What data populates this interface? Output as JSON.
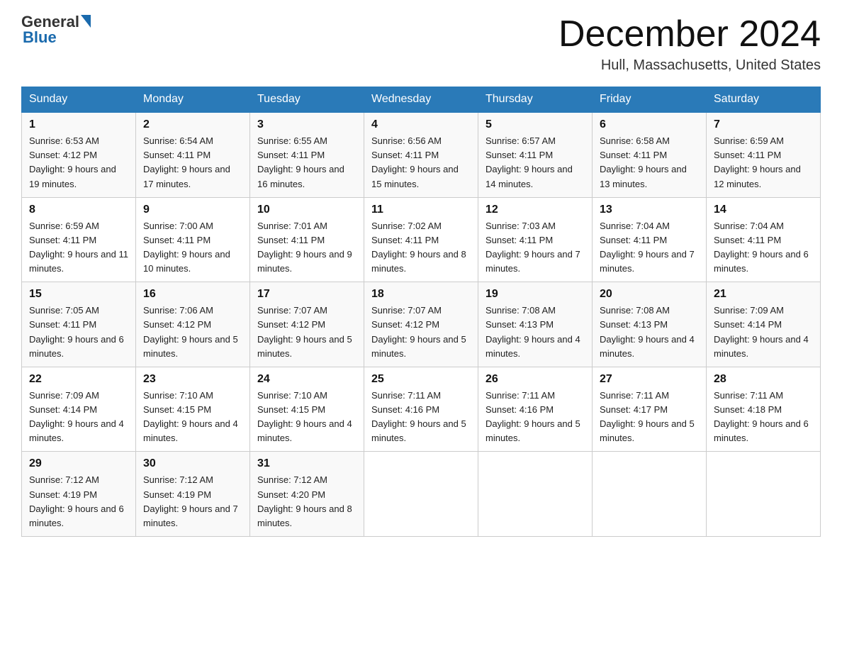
{
  "header": {
    "logo_general": "General",
    "logo_blue": "Blue",
    "month_title": "December 2024",
    "location": "Hull, Massachusetts, United States"
  },
  "days_of_week": [
    "Sunday",
    "Monday",
    "Tuesday",
    "Wednesday",
    "Thursday",
    "Friday",
    "Saturday"
  ],
  "weeks": [
    [
      {
        "num": "1",
        "sunrise": "6:53 AM",
        "sunset": "4:12 PM",
        "daylight": "9 hours and 19 minutes."
      },
      {
        "num": "2",
        "sunrise": "6:54 AM",
        "sunset": "4:11 PM",
        "daylight": "9 hours and 17 minutes."
      },
      {
        "num": "3",
        "sunrise": "6:55 AM",
        "sunset": "4:11 PM",
        "daylight": "9 hours and 16 minutes."
      },
      {
        "num": "4",
        "sunrise": "6:56 AM",
        "sunset": "4:11 PM",
        "daylight": "9 hours and 15 minutes."
      },
      {
        "num": "5",
        "sunrise": "6:57 AM",
        "sunset": "4:11 PM",
        "daylight": "9 hours and 14 minutes."
      },
      {
        "num": "6",
        "sunrise": "6:58 AM",
        "sunset": "4:11 PM",
        "daylight": "9 hours and 13 minutes."
      },
      {
        "num": "7",
        "sunrise": "6:59 AM",
        "sunset": "4:11 PM",
        "daylight": "9 hours and 12 minutes."
      }
    ],
    [
      {
        "num": "8",
        "sunrise": "6:59 AM",
        "sunset": "4:11 PM",
        "daylight": "9 hours and 11 minutes."
      },
      {
        "num": "9",
        "sunrise": "7:00 AM",
        "sunset": "4:11 PM",
        "daylight": "9 hours and 10 minutes."
      },
      {
        "num": "10",
        "sunrise": "7:01 AM",
        "sunset": "4:11 PM",
        "daylight": "9 hours and 9 minutes."
      },
      {
        "num": "11",
        "sunrise": "7:02 AM",
        "sunset": "4:11 PM",
        "daylight": "9 hours and 8 minutes."
      },
      {
        "num": "12",
        "sunrise": "7:03 AM",
        "sunset": "4:11 PM",
        "daylight": "9 hours and 7 minutes."
      },
      {
        "num": "13",
        "sunrise": "7:04 AM",
        "sunset": "4:11 PM",
        "daylight": "9 hours and 7 minutes."
      },
      {
        "num": "14",
        "sunrise": "7:04 AM",
        "sunset": "4:11 PM",
        "daylight": "9 hours and 6 minutes."
      }
    ],
    [
      {
        "num": "15",
        "sunrise": "7:05 AM",
        "sunset": "4:11 PM",
        "daylight": "9 hours and 6 minutes."
      },
      {
        "num": "16",
        "sunrise": "7:06 AM",
        "sunset": "4:12 PM",
        "daylight": "9 hours and 5 minutes."
      },
      {
        "num": "17",
        "sunrise": "7:07 AM",
        "sunset": "4:12 PM",
        "daylight": "9 hours and 5 minutes."
      },
      {
        "num": "18",
        "sunrise": "7:07 AM",
        "sunset": "4:12 PM",
        "daylight": "9 hours and 5 minutes."
      },
      {
        "num": "19",
        "sunrise": "7:08 AM",
        "sunset": "4:13 PM",
        "daylight": "9 hours and 4 minutes."
      },
      {
        "num": "20",
        "sunrise": "7:08 AM",
        "sunset": "4:13 PM",
        "daylight": "9 hours and 4 minutes."
      },
      {
        "num": "21",
        "sunrise": "7:09 AM",
        "sunset": "4:14 PM",
        "daylight": "9 hours and 4 minutes."
      }
    ],
    [
      {
        "num": "22",
        "sunrise": "7:09 AM",
        "sunset": "4:14 PM",
        "daylight": "9 hours and 4 minutes."
      },
      {
        "num": "23",
        "sunrise": "7:10 AM",
        "sunset": "4:15 PM",
        "daylight": "9 hours and 4 minutes."
      },
      {
        "num": "24",
        "sunrise": "7:10 AM",
        "sunset": "4:15 PM",
        "daylight": "9 hours and 4 minutes."
      },
      {
        "num": "25",
        "sunrise": "7:11 AM",
        "sunset": "4:16 PM",
        "daylight": "9 hours and 5 minutes."
      },
      {
        "num": "26",
        "sunrise": "7:11 AM",
        "sunset": "4:16 PM",
        "daylight": "9 hours and 5 minutes."
      },
      {
        "num": "27",
        "sunrise": "7:11 AM",
        "sunset": "4:17 PM",
        "daylight": "9 hours and 5 minutes."
      },
      {
        "num": "28",
        "sunrise": "7:11 AM",
        "sunset": "4:18 PM",
        "daylight": "9 hours and 6 minutes."
      }
    ],
    [
      {
        "num": "29",
        "sunrise": "7:12 AM",
        "sunset": "4:19 PM",
        "daylight": "9 hours and 6 minutes."
      },
      {
        "num": "30",
        "sunrise": "7:12 AM",
        "sunset": "4:19 PM",
        "daylight": "9 hours and 7 minutes."
      },
      {
        "num": "31",
        "sunrise": "7:12 AM",
        "sunset": "4:20 PM",
        "daylight": "9 hours and 8 minutes."
      },
      null,
      null,
      null,
      null
    ]
  ]
}
